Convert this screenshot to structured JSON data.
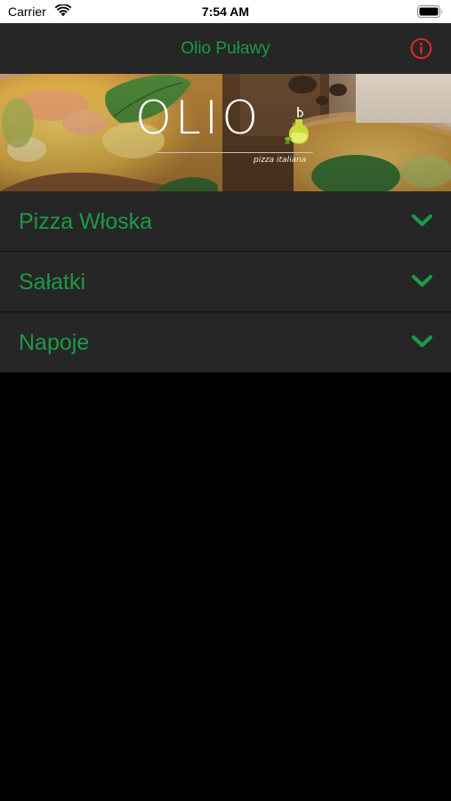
{
  "status_bar": {
    "carrier": "Carrier",
    "time": "7:54 AM"
  },
  "nav": {
    "title": "Olio Puławy",
    "info_icon": "info-circle-icon"
  },
  "hero": {
    "logo_text": "OLIO",
    "tagline": "pizza italiana"
  },
  "categories": [
    {
      "label": "Pizza Włoska",
      "icon": "chevron-down-icon"
    },
    {
      "label": "Sałatki",
      "icon": "chevron-down-icon"
    },
    {
      "label": "Napoje",
      "icon": "chevron-down-icon"
    }
  ],
  "colors": {
    "accent_green": "#1c9a48",
    "info_red": "#e0282e",
    "nav_background": "#262626",
    "row_background": "#262626",
    "page_background": "#000000"
  }
}
